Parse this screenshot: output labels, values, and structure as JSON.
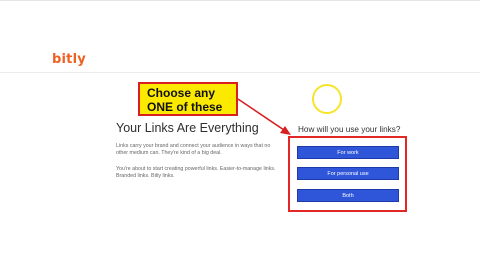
{
  "brand": {
    "logo_text": "bitly",
    "logo_color": "#ee6123"
  },
  "annotation": {
    "callout_line1": "Choose any",
    "callout_line2": "ONE of these"
  },
  "main": {
    "headline": "Your Links Are Everything",
    "paragraph1": "Links carry your brand and connect your audience in ways that no other medium can. They're kind of a big deal.",
    "paragraph2": "You're about to start creating powerful links. Easier-to-manage links. Branded links. Bitly links."
  },
  "question": {
    "label": "How will you use your links?",
    "options": [
      {
        "label": "For work"
      },
      {
        "label": "For personal use"
      },
      {
        "label": "Both"
      }
    ]
  },
  "colors": {
    "button_blue": "#2f56d9",
    "highlight_red": "#e32626",
    "callout_yellow": "#fbe900"
  }
}
